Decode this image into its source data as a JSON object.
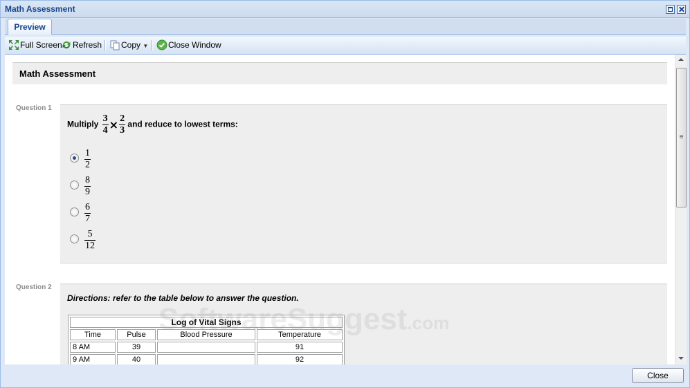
{
  "window": {
    "title": "Math Assessment"
  },
  "tabs": [
    {
      "label": "Preview"
    }
  ],
  "toolbar": {
    "full_screen": "Full Screen",
    "refresh": "Refresh",
    "copy": "Copy",
    "close_window": "Close Window"
  },
  "assessment": {
    "title": "Math Assessment",
    "q1": {
      "label": "Question 1",
      "prefix": "Multiply",
      "a_num": "3",
      "a_den": "4",
      "times": "×",
      "b_num": "2",
      "b_den": "3",
      "suffix": "and reduce to lowest terms:",
      "options": [
        {
          "num": "1",
          "den": "2",
          "selected": true
        },
        {
          "num": "8",
          "den": "9",
          "selected": false
        },
        {
          "num": "6",
          "den": "7",
          "selected": false
        },
        {
          "num": "5",
          "den": "12",
          "selected": false
        }
      ]
    },
    "q2": {
      "label": "Question 2",
      "directions": "Directions: refer to the table below to answer the question.",
      "table": {
        "caption": "Log of Vital Signs",
        "headers": [
          "Time",
          "Pulse",
          "Blood Pressure",
          "Temperature"
        ],
        "rows": [
          [
            "8 AM",
            "39",
            "",
            "91"
          ],
          [
            "9 AM",
            "40",
            "",
            "92"
          ]
        ]
      }
    }
  },
  "watermark": {
    "main": "SoftwareSuggest",
    "suffix": ".com"
  },
  "footer": {
    "close": "Close"
  },
  "colors": {
    "title_blue": "#15428b",
    "frame_border": "#99bbe8",
    "panel_bg": "#dfe8f6"
  }
}
